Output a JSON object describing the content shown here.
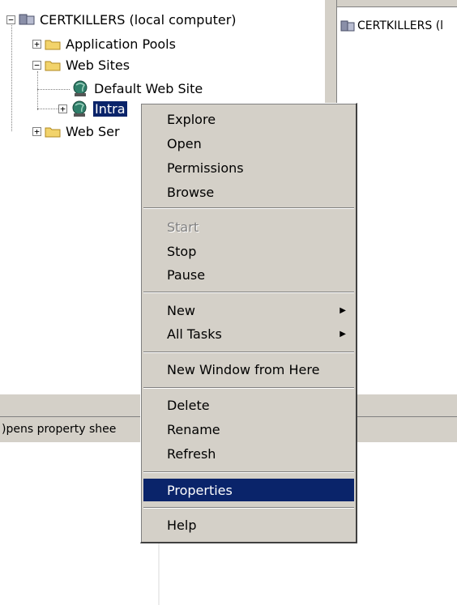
{
  "tree": {
    "root_label": "CERTKILLERS (local computer)",
    "items": [
      {
        "label": "Application Pools"
      },
      {
        "label": "Web Sites"
      },
      {
        "label": "Default Web Site"
      },
      {
        "label": "Intra"
      },
      {
        "label": "Web Ser"
      }
    ]
  },
  "right_pane": {
    "item_label": "CERTKILLERS (l"
  },
  "status_bar": {
    "text": ")pens property shee"
  },
  "context_menu": {
    "items": [
      {
        "label": "Explore"
      },
      {
        "label": "Open"
      },
      {
        "label": "Permissions"
      },
      {
        "label": "Browse"
      },
      {
        "label": "Start"
      },
      {
        "label": "Stop"
      },
      {
        "label": "Pause"
      },
      {
        "label": "New"
      },
      {
        "label": "All Tasks"
      },
      {
        "label": "New Window from Here"
      },
      {
        "label": "Delete"
      },
      {
        "label": "Rename"
      },
      {
        "label": "Refresh"
      },
      {
        "label": "Properties"
      },
      {
        "label": "Help"
      }
    ]
  },
  "colors": {
    "selection": "#0a246a",
    "face": "#d4d0c8",
    "disabled": "#808080"
  }
}
